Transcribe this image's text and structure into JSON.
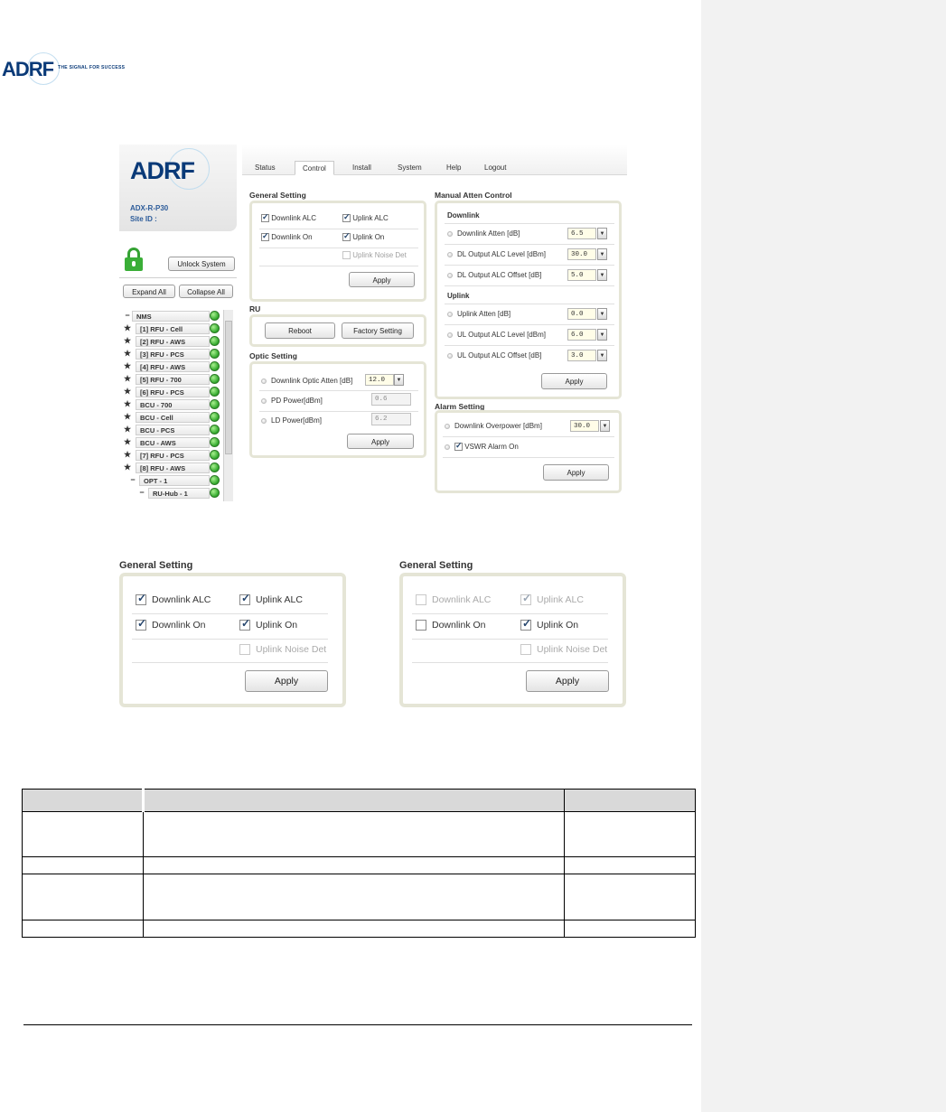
{
  "document": {
    "logo_text": "ADRF",
    "tagline": "THE SIGNAL FOR SUCCESS"
  },
  "app": {
    "logo_text": "ADRF",
    "model": "ADX-R-P30",
    "site_id_label": "Site ID :",
    "tabs": [
      "Status",
      "Control",
      "Install",
      "System",
      "Help",
      "Logout"
    ],
    "active_tab": "Control",
    "unlock_button": "Unlock System",
    "expand_all": "Expand All",
    "collapse_all": "Collapse All"
  },
  "tree": {
    "items": [
      {
        "marker": "−",
        "label": "NMS"
      },
      {
        "marker": "★",
        "label": "[1] RFU - Cell"
      },
      {
        "marker": "★",
        "label": "[2] RFU - AWS"
      },
      {
        "marker": "★",
        "label": "[3] RFU - PCS"
      },
      {
        "marker": "★",
        "label": "[4] RFU - AWS"
      },
      {
        "marker": "★",
        "label": "[5] RFU - 700"
      },
      {
        "marker": "★",
        "label": "[6] RFU - PCS"
      },
      {
        "marker": "★",
        "label": "BCU - 700"
      },
      {
        "marker": "★",
        "label": "BCU - Cell"
      },
      {
        "marker": "★",
        "label": "BCU - PCS"
      },
      {
        "marker": "★",
        "label": "BCU - AWS"
      },
      {
        "marker": "★",
        "label": "[7] RFU - PCS"
      },
      {
        "marker": "★",
        "label": "[8] RFU - AWS"
      },
      {
        "marker": "−",
        "label": "OPT - 1"
      },
      {
        "marker": "−",
        "label": "RU-Hub - 1"
      }
    ],
    "status_color": "#2fa62a"
  },
  "general_setting": {
    "title": "General Setting",
    "downlink_alc": "Downlink ALC",
    "uplink_alc": "Uplink ALC",
    "downlink_on": "Downlink On",
    "uplink_on": "Uplink On",
    "uplink_noise_det": "Uplink Noise Det",
    "apply": "Apply"
  },
  "ru": {
    "title": "RU",
    "reboot": "Reboot",
    "factory_setting": "Factory Setting"
  },
  "optic_setting": {
    "title": "Optic Setting",
    "downlink_optic_atten_label": "Downlink Optic Atten [dB]",
    "downlink_optic_atten_value": "12.0",
    "pd_power_label": "PD Power[dBm]",
    "pd_power_value": "0.6",
    "ld_power_label": "LD Power[dBm]",
    "ld_power_value": "6.2",
    "apply": "Apply"
  },
  "manual_atten": {
    "title": "Manual Atten Control",
    "downlink_header": "Downlink",
    "dl_atten_label": "Downlink Atten [dB]",
    "dl_atten_value": "6.5",
    "dl_alc_level_label": "DL Output ALC Level [dBm]",
    "dl_alc_level_value": "30.0",
    "dl_alc_offset_label": "DL Output ALC Offset [dB]",
    "dl_alc_offset_value": "5.0",
    "uplink_header": "Uplink",
    "ul_atten_label": "Uplink Atten [dB]",
    "ul_atten_value": "0.0",
    "ul_alc_level_label": "UL Output ALC Level [dBm]",
    "ul_alc_level_value": "6.0",
    "ul_alc_offset_label": "UL Output ALC Offset [dB]",
    "ul_alc_offset_value": "3.0",
    "apply": "Apply"
  },
  "alarm_setting": {
    "title": "Alarm Setting",
    "dl_overpower_label": "Downlink Overpower [dBm]",
    "dl_overpower_value": "30.0",
    "vswr_alarm": "VSWR Alarm On",
    "apply": "Apply"
  },
  "enlarged_left": {
    "title": "General Setting",
    "downlink_alc": "Downlink ALC",
    "uplink_alc": "Uplink ALC",
    "downlink_on": "Downlink On",
    "uplink_on": "Uplink On",
    "uplink_noise_det": "Uplink Noise Det",
    "apply": "Apply"
  },
  "enlarged_right": {
    "title": "General Setting",
    "downlink_alc": "Downlink ALC",
    "uplink_alc": "Uplink ALC",
    "downlink_on": "Downlink On",
    "uplink_on": "Uplink On",
    "uplink_noise_det": "Uplink Noise Det",
    "apply": "Apply"
  }
}
